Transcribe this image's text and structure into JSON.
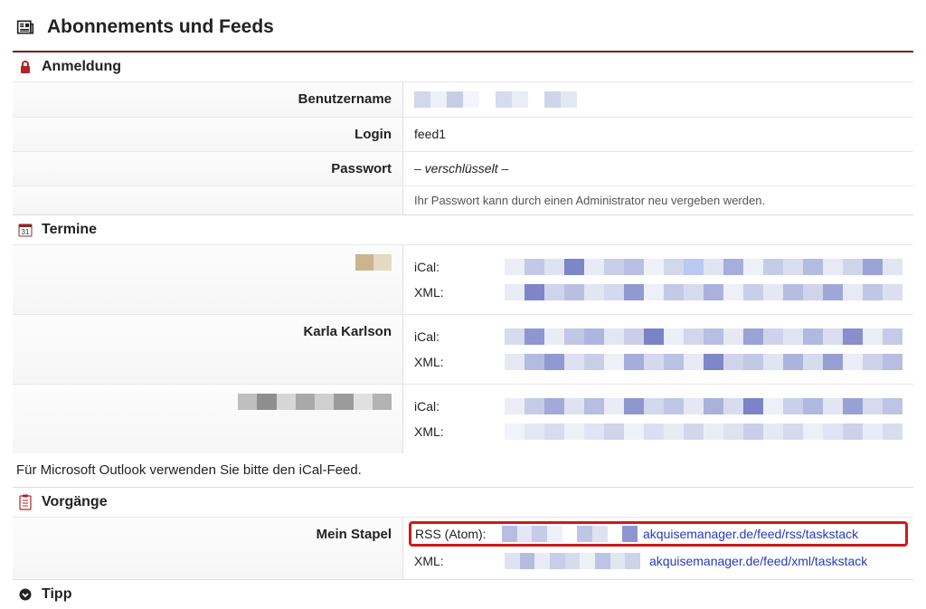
{
  "title": "Abonnements und Feeds",
  "anmeldung": {
    "heading": "Anmeldung",
    "username_label": "Benutzername",
    "login_label": "Login",
    "login_value": "feed1",
    "password_label": "Passwort",
    "password_value": "– verschlüsselt –",
    "password_note": "Ihr Passwort kann durch einen Administrator neu vergeben werden."
  },
  "termine": {
    "heading": "Termine",
    "rows": [
      {
        "name": ""
      },
      {
        "name": "Karla Karlson"
      },
      {
        "name": ""
      }
    ],
    "ical_label": "iCal:",
    "xml_label": "XML:",
    "outlook_note": "Für Microsoft Outlook verwenden Sie bitte den iCal-Feed."
  },
  "vorgaenge": {
    "heading": "Vorgänge",
    "stapel_label": "Mein Stapel",
    "rss_label": "RSS (Atom):",
    "rss_link": "akquisemanager.de/feed/rss/taskstack",
    "xml_label": "XML:",
    "xml_link": "akquisemanager.de/feed/xml/taskstack"
  },
  "tipp": {
    "heading": "Tipp"
  }
}
